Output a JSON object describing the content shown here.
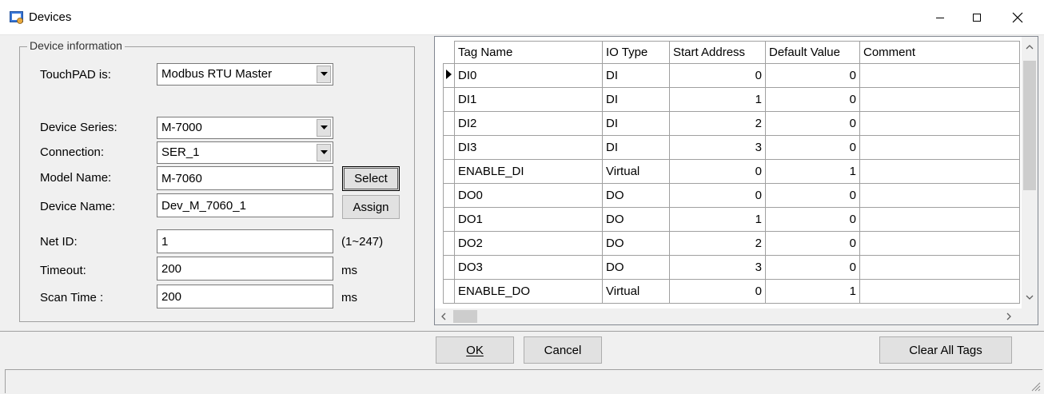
{
  "window": {
    "title": "Devices",
    "controls": {
      "minimize": "minimize-icon",
      "maximize": "maximize-icon",
      "close": "close-icon"
    }
  },
  "device_info": {
    "legend": "Device information",
    "touchpad_label": "TouchPAD is:",
    "touchpad_value": "Modbus RTU Master",
    "series_label": "Device Series:",
    "series_value": "M-7000",
    "connection_label": "Connection:",
    "connection_value": "SER_1",
    "model_label": "Model Name:",
    "model_value": "M-7060",
    "select_button": "Select",
    "device_name_label": "Device Name:",
    "device_name_value": "Dev_M_7060_1",
    "assign_button": "Assign",
    "netid_label": "Net ID:",
    "netid_value": "1",
    "netid_range": "(1~247)",
    "timeout_label": "Timeout:",
    "timeout_value": "200",
    "timeout_unit": "ms",
    "scantime_label": "Scan Time :",
    "scantime_value": "200",
    "scantime_unit": "ms"
  },
  "tags_grid": {
    "columns": [
      "Tag Name",
      "IO Type",
      "Start Address",
      "Default Value",
      "Comment"
    ],
    "rows": [
      {
        "name": "DI0",
        "type": "DI",
        "address": "0",
        "default": "0",
        "comment": "",
        "selected": true
      },
      {
        "name": "DI1",
        "type": "DI",
        "address": "1",
        "default": "0",
        "comment": ""
      },
      {
        "name": "DI2",
        "type": "DI",
        "address": "2",
        "default": "0",
        "comment": ""
      },
      {
        "name": "DI3",
        "type": "DI",
        "address": "3",
        "default": "0",
        "comment": ""
      },
      {
        "name": "ENABLE_DI",
        "type": "Virtual",
        "address": "0",
        "default": "1",
        "comment": ""
      },
      {
        "name": "DO0",
        "type": "DO",
        "address": "0",
        "default": "0",
        "comment": ""
      },
      {
        "name": "DO1",
        "type": "DO",
        "address": "1",
        "default": "0",
        "comment": ""
      },
      {
        "name": "DO2",
        "type": "DO",
        "address": "2",
        "default": "0",
        "comment": ""
      },
      {
        "name": "DO3",
        "type": "DO",
        "address": "3",
        "default": "0",
        "comment": ""
      },
      {
        "name": "ENABLE_DO",
        "type": "Virtual",
        "address": "0",
        "default": "1",
        "comment": ""
      }
    ]
  },
  "footer": {
    "ok_button": "OK",
    "cancel_button": "Cancel",
    "clear_button": "Clear All Tags"
  }
}
